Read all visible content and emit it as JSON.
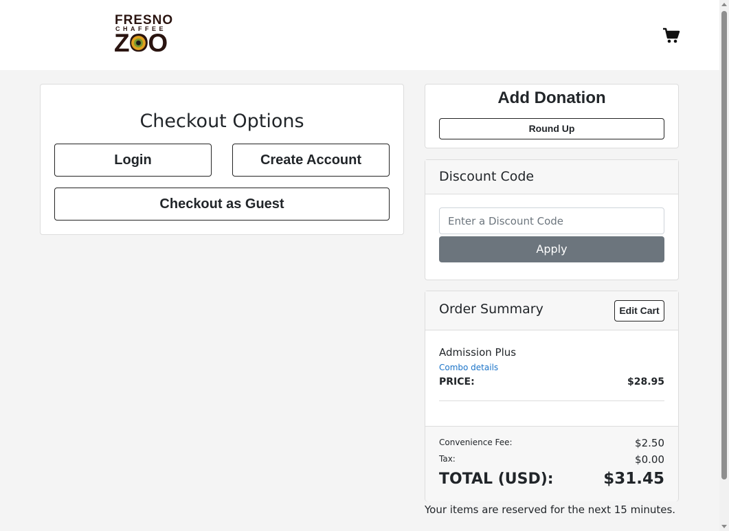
{
  "header": {
    "logo": {
      "line1": "FRESNO",
      "line2": "CHAFFEE",
      "line3": "ZOO"
    },
    "cart_icon": "shopping-cart-icon"
  },
  "checkout": {
    "title": "Checkout Options",
    "login_label": "Login",
    "create_account_label": "Create Account",
    "guest_label": "Checkout as Guest"
  },
  "donation": {
    "title": "Add Donation",
    "round_up_label": "Round Up"
  },
  "discount": {
    "title": "Discount Code",
    "placeholder": "Enter a Discount Code",
    "value": "",
    "apply_label": "Apply"
  },
  "summary": {
    "title": "Order Summary",
    "edit_cart_label": "Edit Cart",
    "items": [
      {
        "name": "Admission Plus",
        "details_link": "Combo details",
        "price_label": "PRICE:",
        "price": "$28.95"
      }
    ],
    "convenience_fee_label": "Convenience Fee:",
    "convenience_fee": "$2.50",
    "tax_label": "Tax:",
    "tax": "$0.00",
    "total_label": "TOTAL (USD):",
    "total": "$31.45"
  },
  "reserved_note": "Your items are reserved for the next 15 minutes.",
  "colors": {
    "page_bg": "#f4f4f4",
    "apply_button": "#6c757d",
    "link": "#1a73c8",
    "logo_brown": "#2a1410"
  }
}
